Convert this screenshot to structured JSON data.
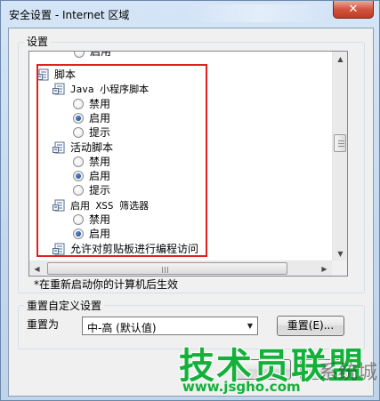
{
  "window": {
    "title": "安全设置 - Internet 区域",
    "close_glyph": "✕"
  },
  "settings_group": {
    "label": "设置",
    "partial_top_item": "启用",
    "items": [
      {
        "kind": "group",
        "label": "脚本",
        "icon": "settings-doc-icon"
      },
      {
        "kind": "subgroup",
        "label": "Java 小程序脚本",
        "icon": "settings-doc-icon"
      },
      {
        "kind": "radio",
        "label": "禁用",
        "checked": false
      },
      {
        "kind": "radio",
        "label": "启用",
        "checked": true
      },
      {
        "kind": "radio",
        "label": "提示",
        "checked": false
      },
      {
        "kind": "subgroup",
        "label": "活动脚本",
        "icon": "settings-doc-icon"
      },
      {
        "kind": "radio",
        "label": "禁用",
        "checked": false
      },
      {
        "kind": "radio",
        "label": "启用",
        "checked": true
      },
      {
        "kind": "radio",
        "label": "提示",
        "checked": false
      },
      {
        "kind": "subgroup",
        "label": "启用 XSS 筛选器",
        "icon": "settings-doc-icon"
      },
      {
        "kind": "radio",
        "label": "禁用",
        "checked": false
      },
      {
        "kind": "radio",
        "label": "启用",
        "checked": true
      },
      {
        "kind": "subgroup",
        "label": "允许对剪贴板进行编程访问",
        "icon": "settings-doc-icon"
      }
    ],
    "restart_note": "*在重新启动你的计算机后生效"
  },
  "reset_group": {
    "label": "重置自定义设置",
    "reset_to_label": "重置为",
    "selected_level": "中-高 (默认值)",
    "reset_button": "重置(E)..."
  },
  "watermark": {
    "brand": "技术员联盟",
    "url": "www.jsgho.com",
    "overlay": "系统城"
  },
  "colors": {
    "highlight_box": "#e02020",
    "watermark_green": "#13b13a"
  }
}
